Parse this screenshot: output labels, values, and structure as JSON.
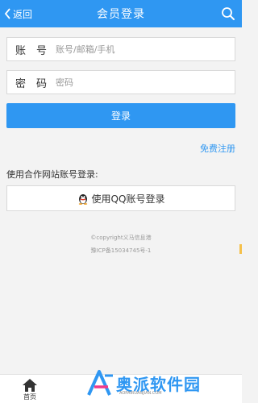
{
  "header": {
    "back_label": "返回",
    "title": "会员登录",
    "search_icon": "search-icon"
  },
  "form": {
    "account_label": "账　号",
    "account_placeholder": "账号/邮箱/手机",
    "account_value": "",
    "password_label": "密　码",
    "password_placeholder": "密码",
    "password_value": "",
    "login_label": "登录"
  },
  "register_label": "免费注册",
  "partner": {
    "heading": "使用合作网站账号登录:",
    "qq_label": "使用QQ账号登录",
    "qq_icon": "qq-penguin-icon"
  },
  "copyright": {
    "line1": "©copyright义马信息港",
    "line2": "豫ICP备15034745号-1"
  },
  "footer": {
    "home_label": "首页",
    "home_icon": "home-icon"
  },
  "watermark": {
    "brand": "奥派软件园",
    "url": "AOPAIRUANJIAN.COM"
  },
  "colors": {
    "accent": "#2f97f2",
    "background": "#f3f3f3"
  }
}
